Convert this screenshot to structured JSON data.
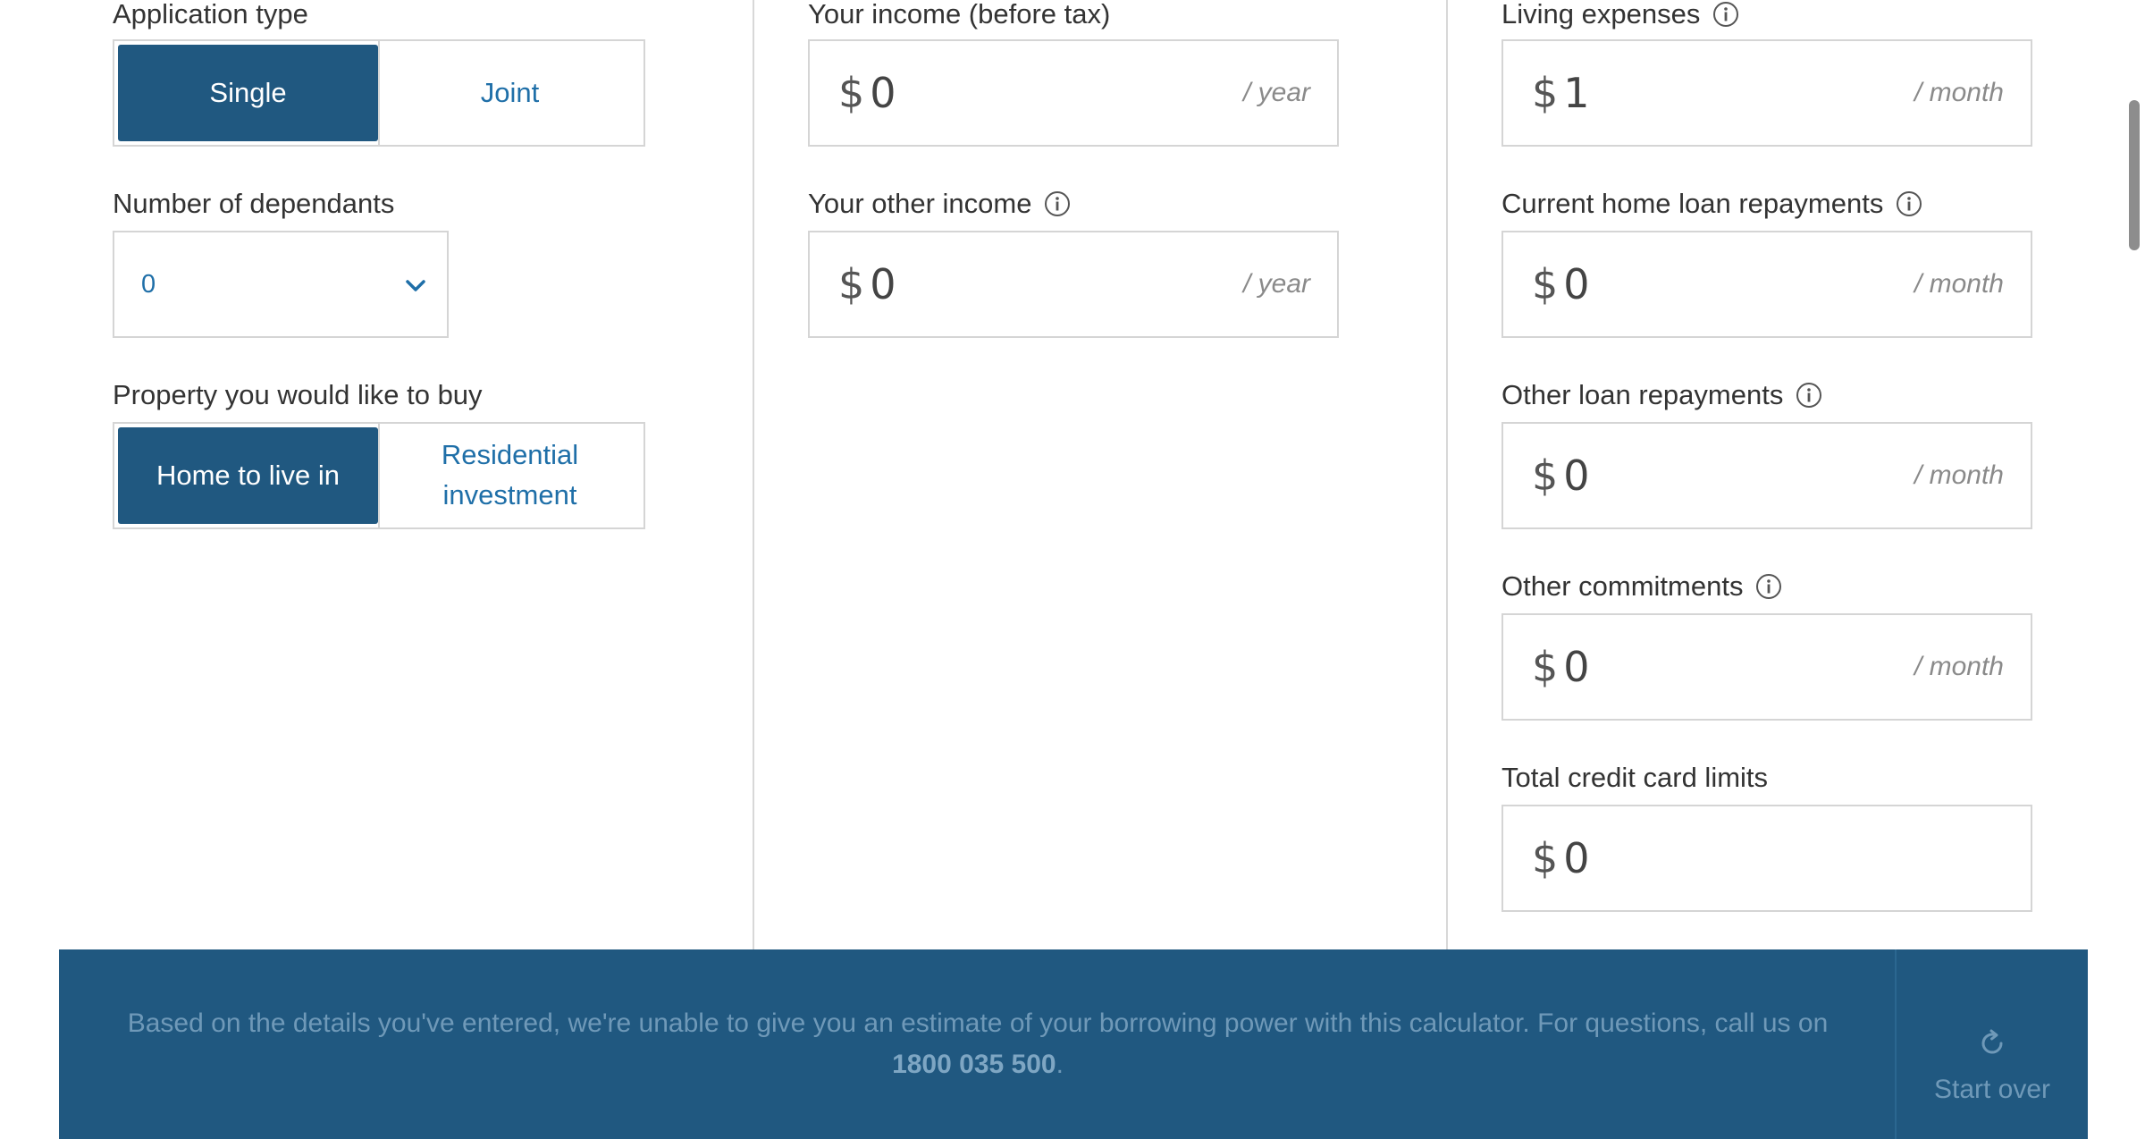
{
  "left": {
    "application_type_label": "Application type",
    "application_type_options": [
      "Single",
      "Joint"
    ],
    "application_type_selected": "Single",
    "dependants_label": "Number of dependants",
    "dependants_value": "0",
    "property_label": "Property you would like to buy",
    "property_options": [
      "Home to live in",
      "Residential investment"
    ],
    "property_option_2_line1": "Residential",
    "property_option_2_line2": "investment",
    "property_selected": "Home to live in"
  },
  "middle": {
    "income_label": "Your income (before tax)",
    "income_currency": "$",
    "income_value": "0",
    "income_unit": "/ year",
    "other_income_label": "Your other income",
    "other_income_currency": "$",
    "other_income_value": "0",
    "other_income_unit": "/ year"
  },
  "right": {
    "living_label": "Living expenses",
    "living_currency": "$",
    "living_value": "1",
    "living_unit": "/ month",
    "home_loan_label": "Current home loan repayments",
    "home_loan_currency": "$",
    "home_loan_value": "0",
    "home_loan_unit": "/ month",
    "other_loan_label": "Other loan repayments",
    "other_loan_currency": "$",
    "other_loan_value": "0",
    "other_loan_unit": "/ month",
    "commitments_label": "Other commitments",
    "commitments_currency": "$",
    "commitments_value": "0",
    "commitments_unit": "/ month",
    "credit_label": "Total credit card limits",
    "credit_currency": "$",
    "credit_value": "0"
  },
  "banner": {
    "message_pre": "Based on the details you've entered, we're unable to give you an estimate of your borrowing power with this calculator. For questions, call us on ",
    "phone": "1800 035 500",
    "message_post": ".",
    "start_over_label": "Start over"
  },
  "colors": {
    "accent": "#205880",
    "link": "#1f6fa8",
    "border": "#d5d5d5"
  },
  "icons": {
    "info": "info-icon",
    "chevron": "chevron-down-icon",
    "refresh": "refresh-icon"
  }
}
